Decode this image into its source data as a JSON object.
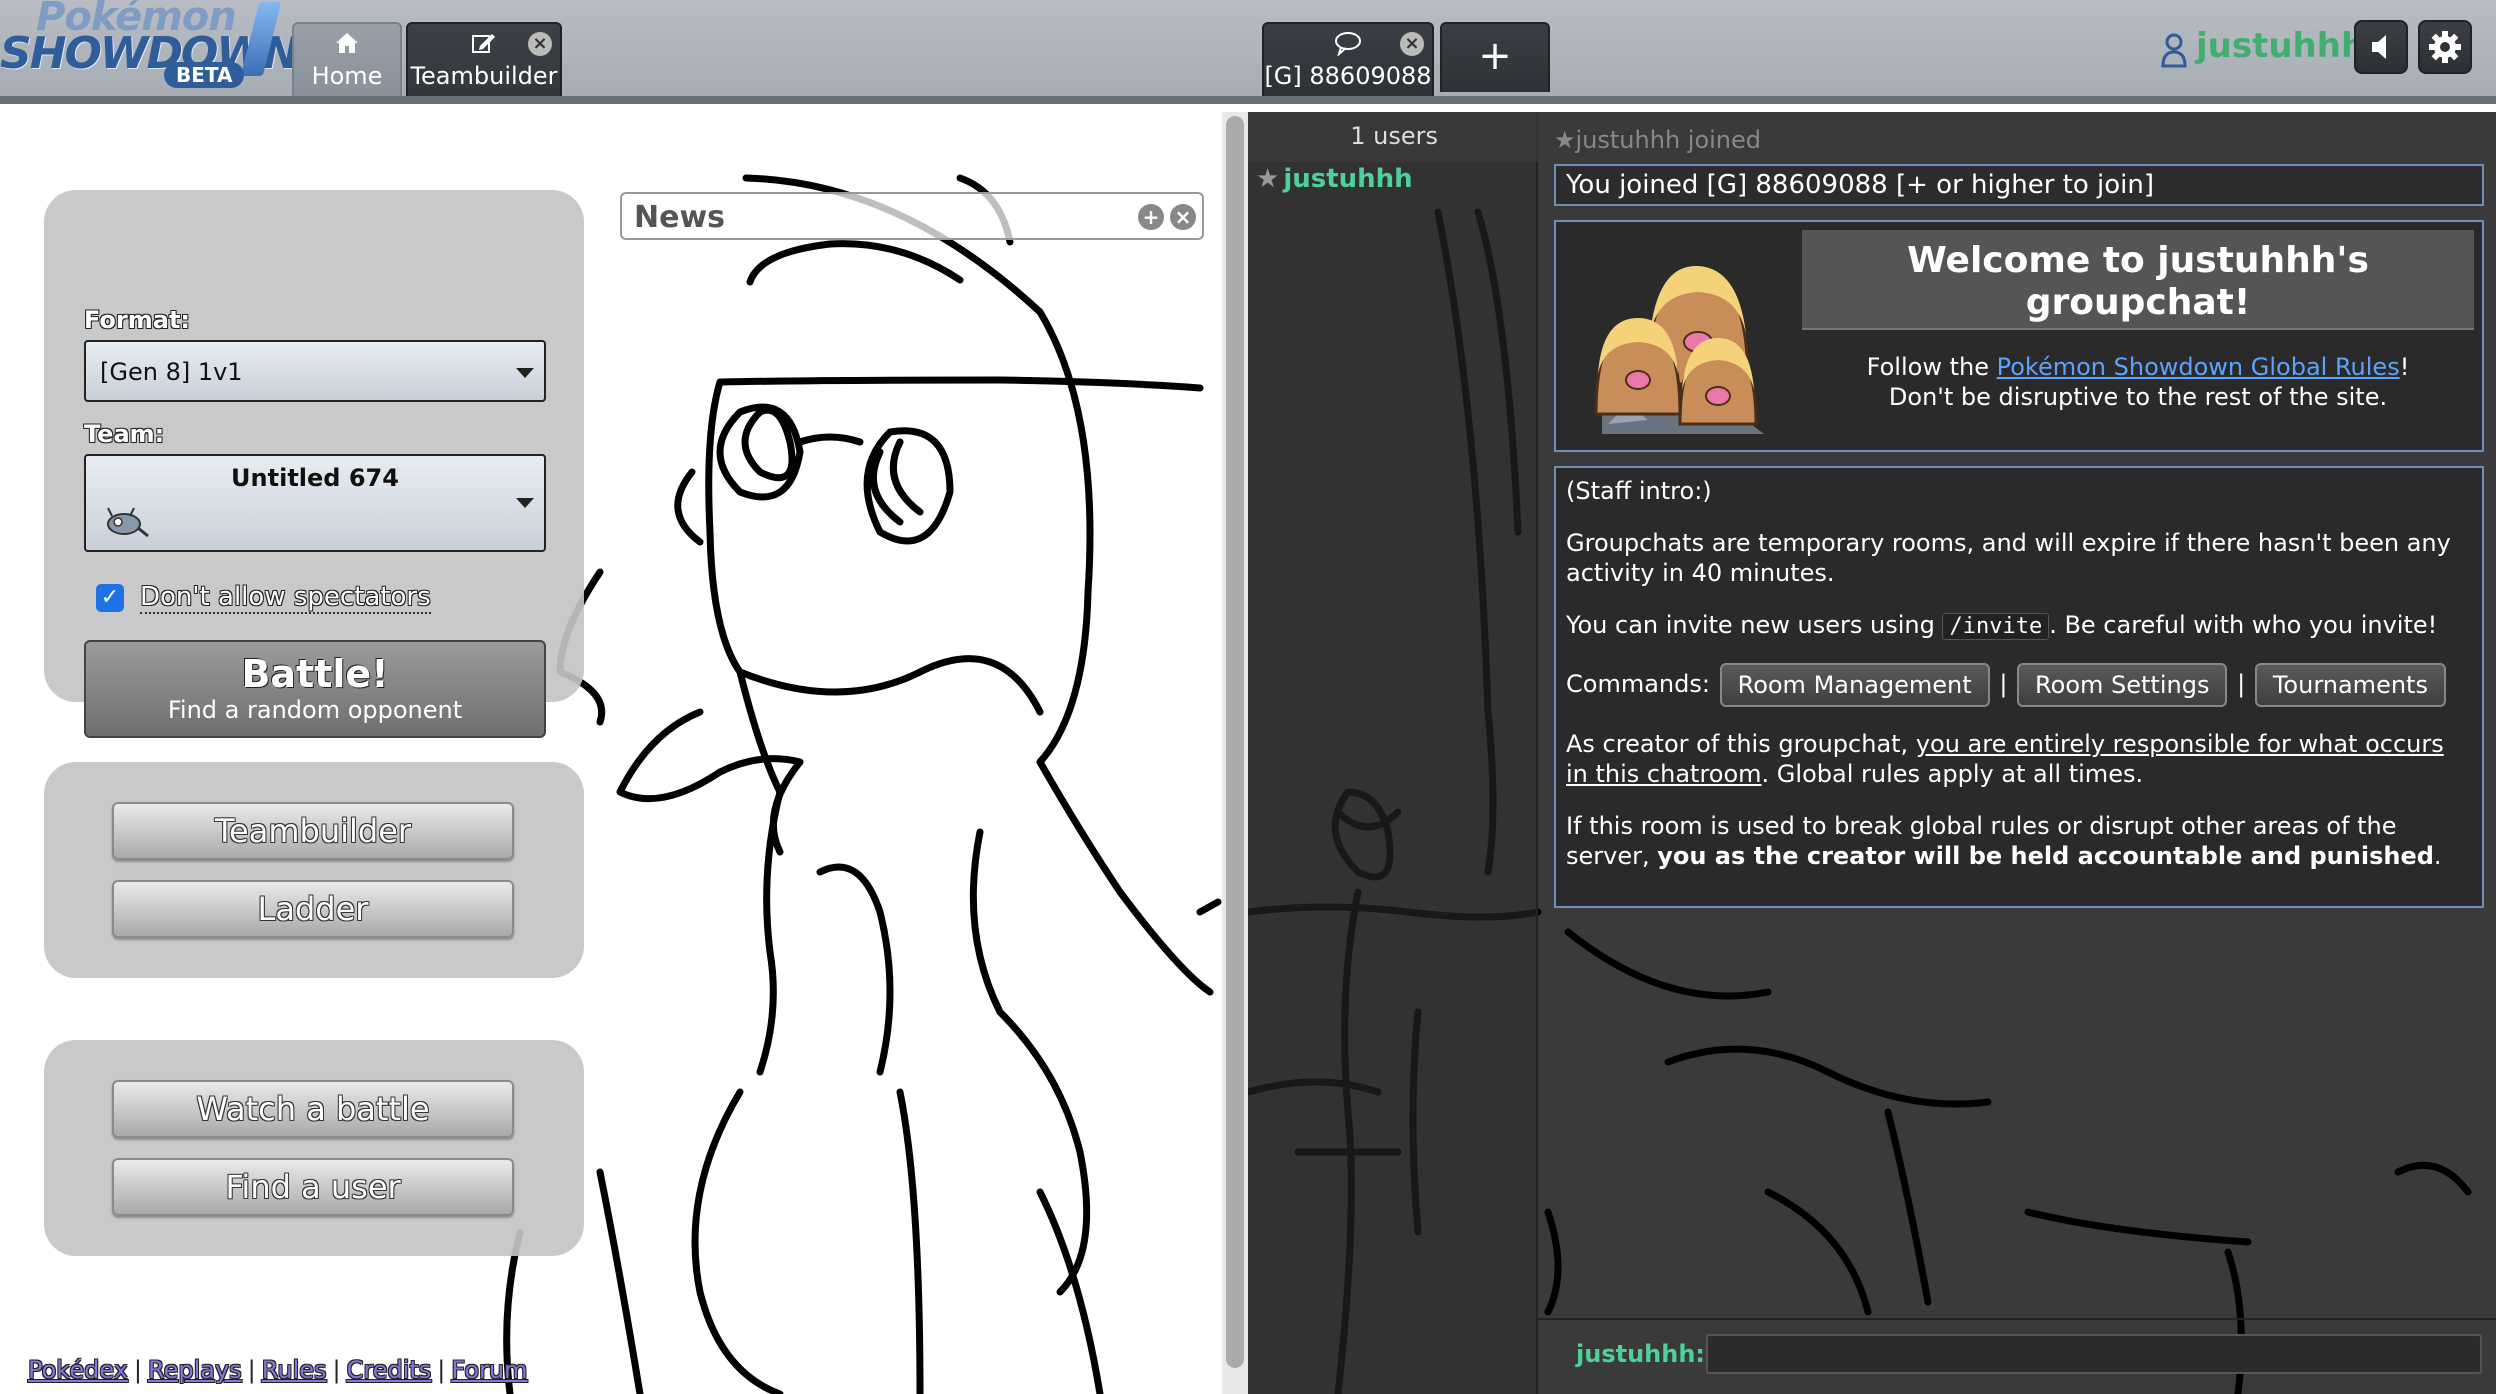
{
  "header": {
    "logo_text_top": "Pokémon",
    "logo_text_main": "SHOWDOWN",
    "logo_badge": "BETA",
    "tabs": [
      {
        "label": "Home",
        "icon": "home-icon"
      },
      {
        "label": "Teambuilder",
        "icon": "pencil-icon"
      },
      {
        "label": "[G] 88609088",
        "icon": "chat-bubble-icon"
      },
      {
        "label": "+",
        "icon": "plus-icon"
      }
    ],
    "username": "justuhhh"
  },
  "main": {
    "format_label": "Format:",
    "format_value": "[Gen 8] 1v1",
    "team_label": "Team:",
    "team_value": "Untitled 674",
    "spectators_label": "Don't allow spectators",
    "spectators_checked": true,
    "battle_title": "Battle!",
    "battle_subtitle": "Find a random opponent",
    "buttons": {
      "teambuilder": "Teambuilder",
      "ladder": "Ladder",
      "watch": "Watch a battle",
      "find_user": "Find a user"
    },
    "news_title": "News",
    "footer_links": [
      "Pokédex",
      "Replays",
      "Rules",
      "Credits",
      "Forum"
    ]
  },
  "room": {
    "user_count": "1 users",
    "users": [
      {
        "rank": "★",
        "name": "justuhhh"
      }
    ],
    "join_notice": "★justuhhh joined",
    "joined_message": "You joined [G] 88609088 [+ or higher to join]",
    "welcome_title": "Welcome to justuhhh's groupchat!",
    "welcome_follow_prefix": "Follow the ",
    "welcome_rules_link": "Pokémon Showdown Global Rules",
    "welcome_follow_suffix": "!",
    "welcome_disruptive": "Don't be disruptive to the rest of the site.",
    "staff_intro": "(Staff intro:)",
    "staff_expire": "Groupchats are temporary rooms, and will expire if there hasn't been any activity in 40 minutes.",
    "staff_invite_prefix": "You can invite new users using ",
    "staff_invite_code": "/invite",
    "staff_invite_suffix": ". Be careful with who you invite!",
    "commands_label": "Commands:",
    "commands": [
      "Room Management",
      "Room Settings",
      "Tournaments"
    ],
    "command_sep": "|",
    "creator_prefix": "As creator of this groupchat, ",
    "creator_link": "you are entirely responsible for what occurs in this chatroom",
    "creator_suffix": ". Global rules apply at all times.",
    "break_prefix": "If this room is used to break global rules or disrupt other areas of the server, ",
    "break_bold": "you as the creator will be held accountable and punished",
    "break_suffix": ".",
    "input_label": "justuhhh:",
    "input_value": ""
  },
  "colors": {
    "username": "#3fae6f",
    "userlist_name": "#4dd09a",
    "link": "#5aa3ff",
    "box_border": "#6d8fb7",
    "checkbox": "#1f72e6"
  }
}
